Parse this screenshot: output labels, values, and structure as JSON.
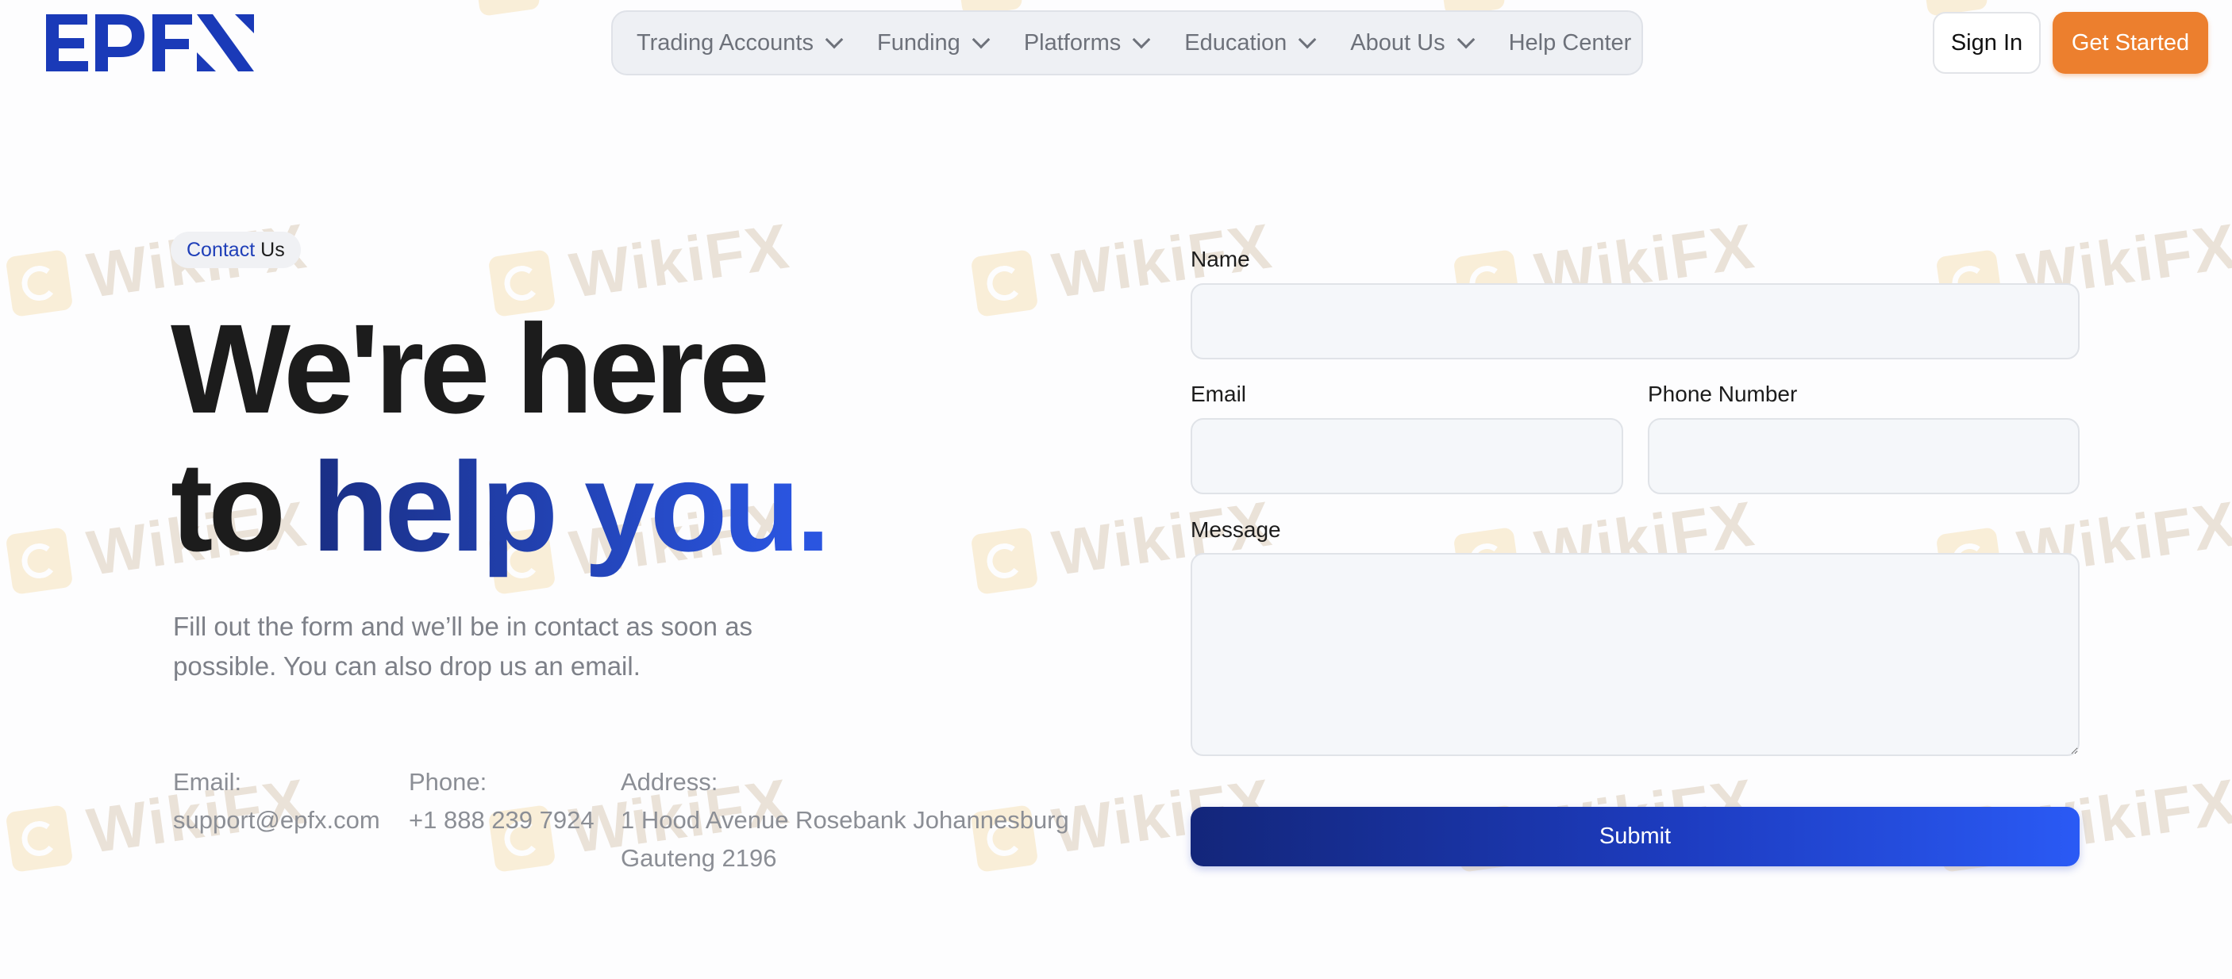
{
  "brand": {
    "logo_text": "EPFX",
    "color": "#1a3ab8"
  },
  "nav": {
    "items": [
      {
        "label": "Trading Accounts",
        "has_dropdown": true
      },
      {
        "label": "Funding",
        "has_dropdown": true
      },
      {
        "label": "Platforms",
        "has_dropdown": true
      },
      {
        "label": "Education",
        "has_dropdown": true
      },
      {
        "label": "About Us",
        "has_dropdown": true
      },
      {
        "label": "Help Center",
        "has_dropdown": false
      }
    ]
  },
  "header": {
    "signin_label": "Sign In",
    "get_started_label": "Get Started"
  },
  "hero": {
    "pill": {
      "accent": "Contact",
      "rest": "Us"
    },
    "headline_line1": "We're here",
    "headline_line2_plain": "to",
    "headline_line2_accent": "help you",
    "headline_dot": ".",
    "subtext": "Fill out the form and we’ll be in contact as soon as possible. You can also drop us an email."
  },
  "contact": {
    "email_label": "Email:",
    "email_value": "support@epfx.com",
    "phone_label": "Phone:",
    "phone_value": "+1 888 239 7924",
    "address_label": "Address:",
    "address_line1": "1 Hood Avenue Rosebank Johannesburg",
    "address_line2": "Gauteng 2196"
  },
  "form": {
    "name_label": "Name",
    "name_value": "",
    "email_label": "Email",
    "email_value": "",
    "phone_label": "Phone Number",
    "phone_value": "",
    "message_label": "Message",
    "message_value": "",
    "submit_label": "Submit"
  },
  "watermark": {
    "text": "WikiFX"
  },
  "colors": {
    "accent_orange": "#ec7f2e",
    "accent_blue": "#2a55e0",
    "dark_blue": "#13267a"
  }
}
